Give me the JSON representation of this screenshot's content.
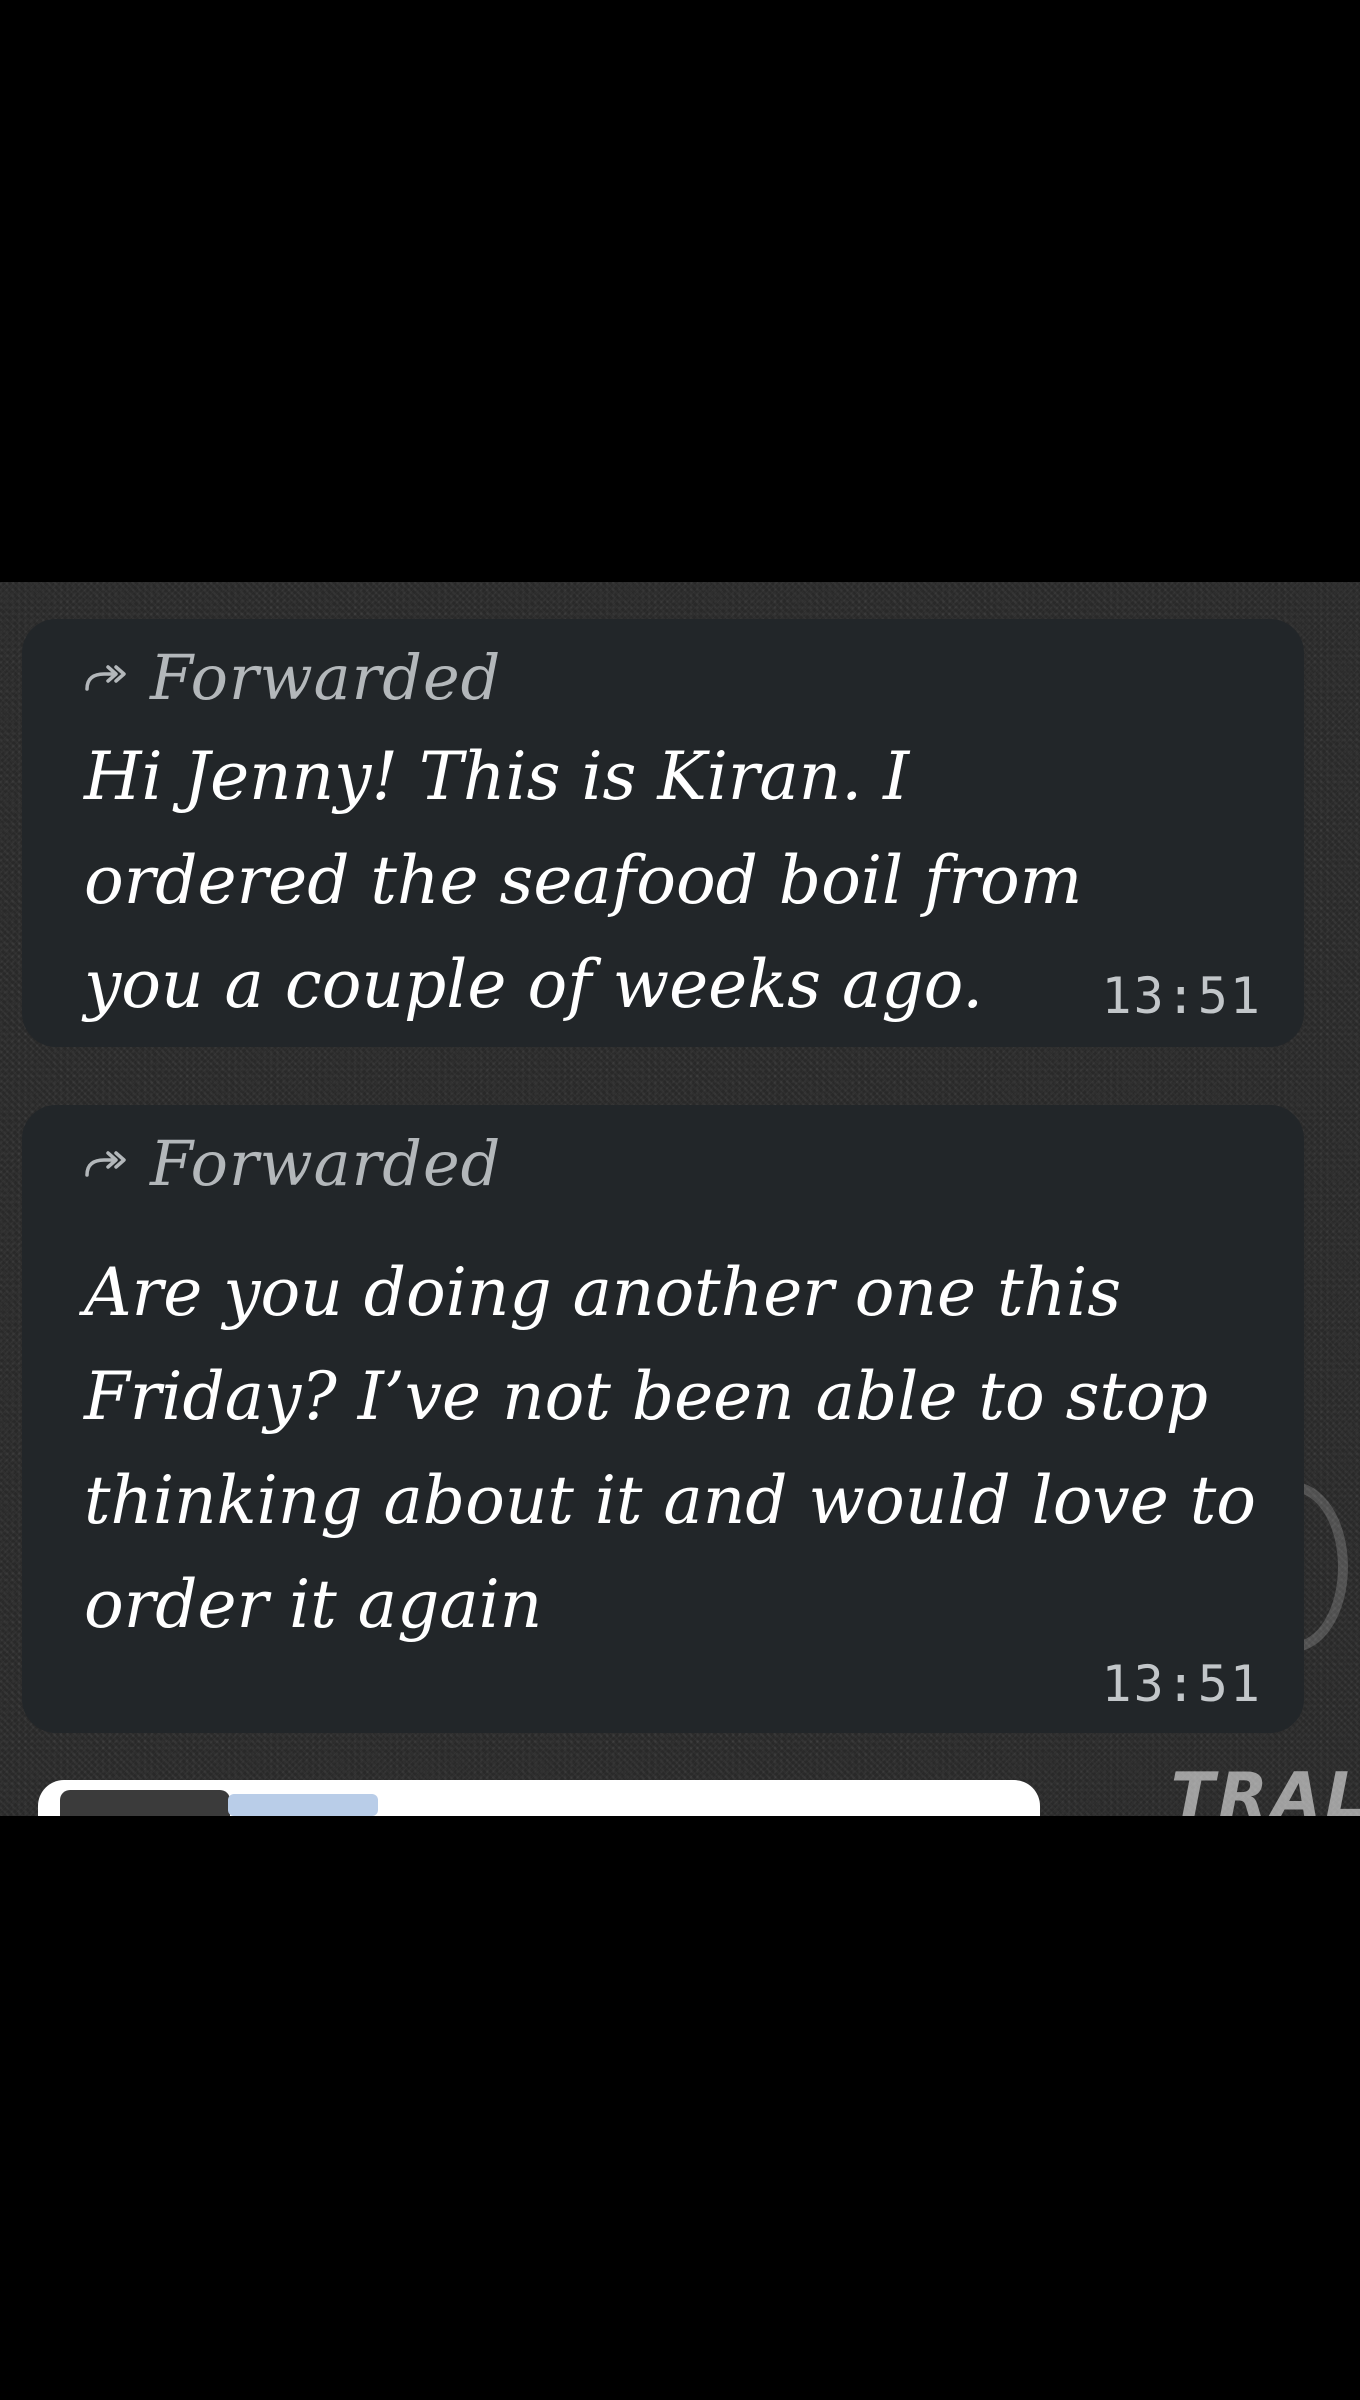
{
  "messages": [
    {
      "forwarded_label": "Forwarded",
      "text": "Hi Jenny! This is Kiran. I ordered the seafood boil from you a couple of weeks ago.",
      "time": "13:51"
    },
    {
      "forwarded_label": "Forwarded",
      "text": "Are you doing another one this Friday? I’ve not been able to stop thinking about it and would love to order it again",
      "time": "13:51"
    }
  ],
  "icons": {
    "forward": "forward-arrow-icon"
  },
  "colors": {
    "bubble": "#222629",
    "forwarded_label": "#b3b7ba",
    "message_text": "#ffffff",
    "timestamp": "#c2c6c9",
    "page_background": "#000000"
  }
}
